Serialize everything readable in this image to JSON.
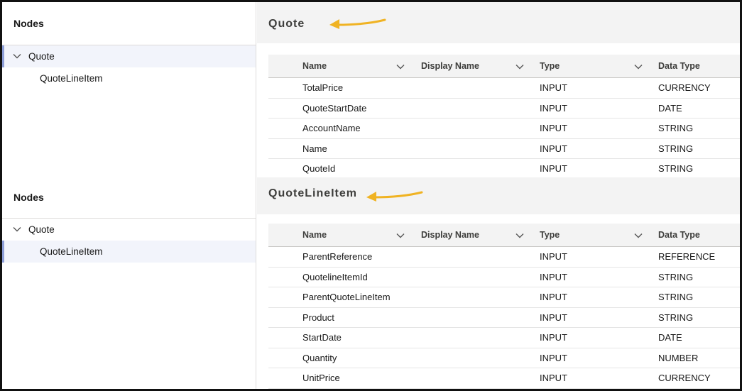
{
  "top": {
    "nodes_title": "Nodes",
    "tree": {
      "parent": "Quote",
      "child": "QuoteLineItem",
      "selected": "Quote"
    },
    "panel_title": "Quote",
    "columns": [
      "Name",
      "Display Name",
      "Type",
      "Data Type"
    ],
    "rows": [
      {
        "name": "TotalPrice",
        "display": "",
        "type": "INPUT",
        "dtype": "CURRENCY"
      },
      {
        "name": "QuoteStartDate",
        "display": "",
        "type": "INPUT",
        "dtype": "DATE"
      },
      {
        "name": "AccountName",
        "display": "",
        "type": "INPUT",
        "dtype": "STRING"
      },
      {
        "name": "Name",
        "display": "",
        "type": "INPUT",
        "dtype": "STRING"
      },
      {
        "name": "QuoteId",
        "display": "",
        "type": "INPUT",
        "dtype": "STRING"
      }
    ]
  },
  "bottom": {
    "nodes_title": "Nodes",
    "tree": {
      "parent": "Quote",
      "child": "QuoteLineItem",
      "selected": "QuoteLineItem"
    },
    "panel_title": "QuoteLineItem",
    "columns": [
      "Name",
      "Display Name",
      "Type",
      "Data Type"
    ],
    "rows": [
      {
        "name": "ParentReference",
        "display": "",
        "type": "INPUT",
        "dtype": "REFERENCE"
      },
      {
        "name": "QuotelineItemId",
        "display": "",
        "type": "INPUT",
        "dtype": "STRING"
      },
      {
        "name": "ParentQuoteLineItem",
        "display": "",
        "type": "INPUT",
        "dtype": "STRING"
      },
      {
        "name": "Product",
        "display": "",
        "type": "INPUT",
        "dtype": "STRING"
      },
      {
        "name": "StartDate",
        "display": "",
        "type": "INPUT",
        "dtype": "DATE"
      },
      {
        "name": "Quantity",
        "display": "",
        "type": "INPUT",
        "dtype": "NUMBER"
      },
      {
        "name": "UnitPrice",
        "display": "",
        "type": "INPUT",
        "dtype": "CURRENCY"
      }
    ]
  },
  "icons": {
    "tree_expand": "chevron-down-icon",
    "column_menu": "chevron-down-icon",
    "annotation": "arrow-left-icon"
  },
  "colors": {
    "arrow": "#f0b323",
    "selected_bg": "#f2f4fb",
    "selected_border": "#8d9ed8",
    "header_bg": "#f3f3f3"
  }
}
